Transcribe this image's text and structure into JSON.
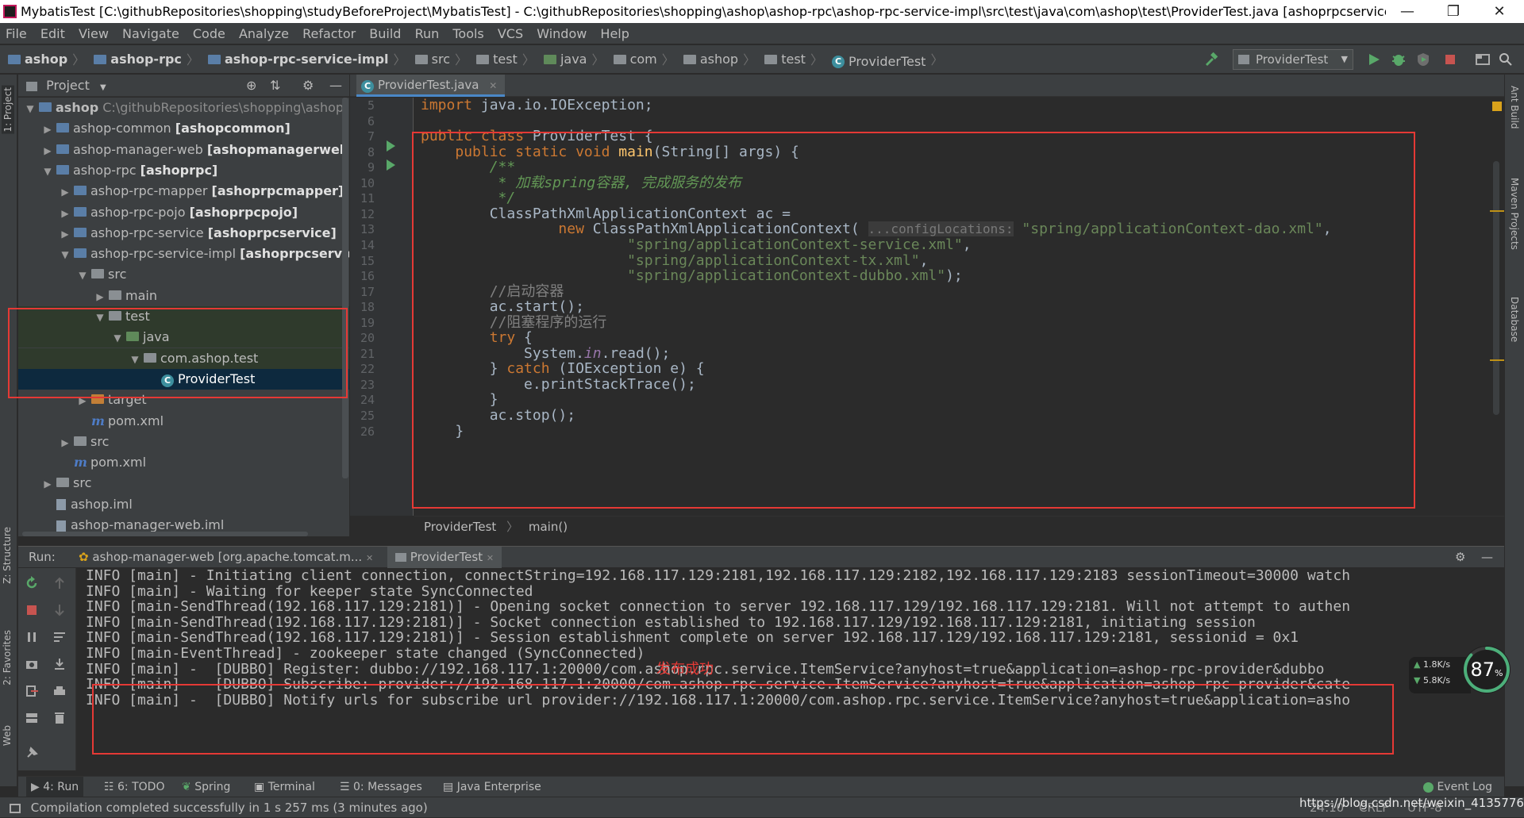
{
  "window": {
    "title": "MybatisTest [C:\\githubRepositories\\shopping\\studyBeforeProject\\MybatisTest] - C:\\githubRepositories\\shopping\\ashop\\ashop-rpc\\ashop-rpc-service-impl\\src\\test\\java\\com\\ashop\\test\\ProviderTest.java [ashoprpcserviceimpl] - Intelli...",
    "minimize": "—",
    "maximize": "❐",
    "close": "✕"
  },
  "menu": [
    "File",
    "Edit",
    "View",
    "Navigate",
    "Code",
    "Analyze",
    "Refactor",
    "Build",
    "Run",
    "Tools",
    "VCS",
    "Window",
    "Help"
  ],
  "breadcrumb": [
    "ashop",
    "ashop-rpc",
    "ashop-rpc-service-impl",
    "src",
    "test",
    "java",
    "com",
    "ashop",
    "test",
    "ProviderTest"
  ],
  "run_config": "ProviderTest",
  "left_stripe": {
    "project": "1: Project",
    "structure": "Z: Structure",
    "favorites": "2: Favorites",
    "web": "Web"
  },
  "right_stripe": {
    "ant": "Ant Build",
    "maven": "Maven Projects",
    "database": "Database"
  },
  "project_panel": {
    "title": "Project",
    "tree": [
      {
        "label": "ashop",
        "suffix": " C:\\githubRepositories\\shopping\\ashop",
        "indent": 0,
        "arrow": "▼",
        "icon": "blue"
      },
      {
        "label": "ashop-common ",
        "bold": "[ashopcommon]",
        "indent": 1,
        "arrow": "▶",
        "icon": "blue"
      },
      {
        "label": "ashop-manager-web ",
        "bold": "[ashopmanagerweb]",
        "indent": 1,
        "arrow": "▶",
        "icon": "blue"
      },
      {
        "label": "ashop-rpc ",
        "bold": "[ashoprpc]",
        "indent": 1,
        "arrow": "▼",
        "icon": "blue"
      },
      {
        "label": "ashop-rpc-mapper ",
        "bold": "[ashoprpcmapper]",
        "indent": 2,
        "arrow": "▶",
        "icon": "blue"
      },
      {
        "label": "ashop-rpc-pojo ",
        "bold": "[ashoprpcpojo]",
        "indent": 2,
        "arrow": "▶",
        "icon": "blue"
      },
      {
        "label": "ashop-rpc-service ",
        "bold": "[ashoprpcservice]",
        "indent": 2,
        "arrow": "▶",
        "icon": "blue"
      },
      {
        "label": "ashop-rpc-service-impl ",
        "bold": "[ashoprpcserviceim",
        "indent": 2,
        "arrow": "▼",
        "icon": "blue"
      },
      {
        "label": "src",
        "indent": 3,
        "arrow": "▼",
        "icon": "src"
      },
      {
        "label": "main",
        "indent": 4,
        "arrow": "▶",
        "icon": "src"
      },
      {
        "label": "test",
        "indent": 4,
        "arrow": "▼",
        "icon": "src",
        "hl": true
      },
      {
        "label": "java",
        "indent": 5,
        "arrow": "▼",
        "icon": "test",
        "hl": true
      },
      {
        "label": "com.ashop.test",
        "indent": 6,
        "arrow": "▼",
        "icon": "src",
        "hl": true
      },
      {
        "label": "ProviderTest",
        "indent": 7,
        "arrow": "",
        "icon": "class",
        "sel": true
      },
      {
        "label": "target",
        "indent": 3,
        "arrow": "▶",
        "icon": "orange"
      },
      {
        "label": "pom.xml",
        "indent": 3,
        "arrow": "",
        "icon": "maven"
      },
      {
        "label": "src",
        "indent": 2,
        "arrow": "▶",
        "icon": "src"
      },
      {
        "label": "pom.xml",
        "indent": 2,
        "arrow": "",
        "icon": "maven"
      },
      {
        "label": "src",
        "indent": 1,
        "arrow": "▶",
        "icon": "src"
      },
      {
        "label": "ashop.iml",
        "indent": 1,
        "arrow": "",
        "icon": "iml"
      },
      {
        "label": "ashop-manager-web.iml",
        "indent": 1,
        "arrow": "",
        "icon": "iml"
      }
    ]
  },
  "editor": {
    "tab": "ProviderTest.java",
    "line_numbers": [
      "5",
      "6",
      "7",
      "8",
      "9",
      "10",
      "11",
      "12",
      "13",
      "14",
      "15",
      "16",
      "17",
      "18",
      "19",
      "20",
      "21",
      "22",
      "23",
      "24",
      "25",
      "26"
    ],
    "lines": [
      "<span class='kw'>import</span> java.io.IOException;",
      "",
      "<span class='kw'>public class</span> ProviderTest {",
      "    <span class='kw'>public static void</span> <span class='fn'>main</span>(String[] args) {",
      "        <span class='doc'>/**</span>",
      "<span class='doc'>         * 加载spring容器, 完成服务的发布</span>",
      "<span class='doc'>         */</span>",
      "        ClassPathXmlApplicationContext ac =",
      "                <span class='kw'>new</span> ClassPathXmlApplicationContext( <span class='hint'>...configLocations:</span> <span class='str'>\"spring/applicationContext-dao.xml\"</span>,",
      "                        <span class='str'>\"spring/applicationContext-service.xml\"</span>,",
      "                        <span class='str'>\"spring/applicationContext-tx.xml\"</span>,",
      "                        <span class='str'>\"spring/applicationContext-dubbo.xml\"</span>);",
      "        <span class='cm'>//启动容器</span>",
      "        ac.start();",
      "        <span class='cm'>//阻塞程序的运行</span>",
      "        <span class='kw'>try</span> {",
      "            System.<span class='st'>in</span>.read();",
      "        } <span class='kw'>catch</span> (IOException e) {",
      "            e.printStackTrace();",
      "        }",
      "        ac.stop();",
      "    }"
    ],
    "breadcrumb": [
      "ProviderTest",
      "main()"
    ]
  },
  "run_panel": {
    "label": "Run:",
    "tabs": [
      "ashop-manager-web [org.apache.tomcat.m...",
      "ProviderTest"
    ],
    "console": [
      "INFO [main] - Initiating client connection, connectString=192.168.117.129:2181,192.168.117.129:2182,192.168.117.129:2183 sessionTimeout=30000 watch",
      "INFO [main] - Waiting for keeper state SyncConnected",
      "INFO [main-SendThread(192.168.117.129:2181)] - Opening socket connection to server 192.168.117.129/192.168.117.129:2181. Will not attempt to authen",
      "INFO [main-SendThread(192.168.117.129:2181)] - Socket connection established to 192.168.117.129/192.168.117.129:2181, initiating session",
      "INFO [main-SendThread(192.168.117.129:2181)] - Session establishment complete on server 192.168.117.129/192.168.117.129:2181, sessionid = 0x1",
      "INFO [main-EventThread] - zookeeper state changed (SyncConnected)",
      "INFO [main] -  [DUBBO] Register: dubbo://192.168.117.1:20000/com.ashop.rpc.service.ItemService?anyhost=true&application=ashop-rpc-provider&dubbo",
      "INFO [main] -  [DUBBO] Subscribe: provider://192.168.117.1:20000/com.ashop.rpc.service.ItemService?anyhost=true&application=ashop-rpc-provider&cate",
      "INFO [main] -  [DUBBO] Notify urls for subscribe url provider://192.168.117.1:20000/com.ashop.rpc.service.ItemService?anyhost=true&application=asho"
    ],
    "annotation": "发布成功"
  },
  "gauge": {
    "percent": "87",
    "unit": "%",
    "up": "1.8K/s",
    "down": "5.8K/s"
  },
  "bottom_tools": [
    "4: Run",
    "6: TODO",
    "Spring",
    "Terminal",
    "0: Messages",
    "Java Enterprise"
  ],
  "event_log": "Event Log",
  "status": {
    "message": "Compilation completed successfully in 1 s 257 ms (3 minutes ago)",
    "position": "24:10",
    "line_sep": "CRLF",
    "encoding": "UTF-8",
    "watermark": "https://blog.csdn.net/weixin_41357767"
  },
  "colors": {
    "highlight_box": "#e53935",
    "keyword": "#cc7832",
    "string": "#6a8759",
    "selection": "#0d293e"
  }
}
